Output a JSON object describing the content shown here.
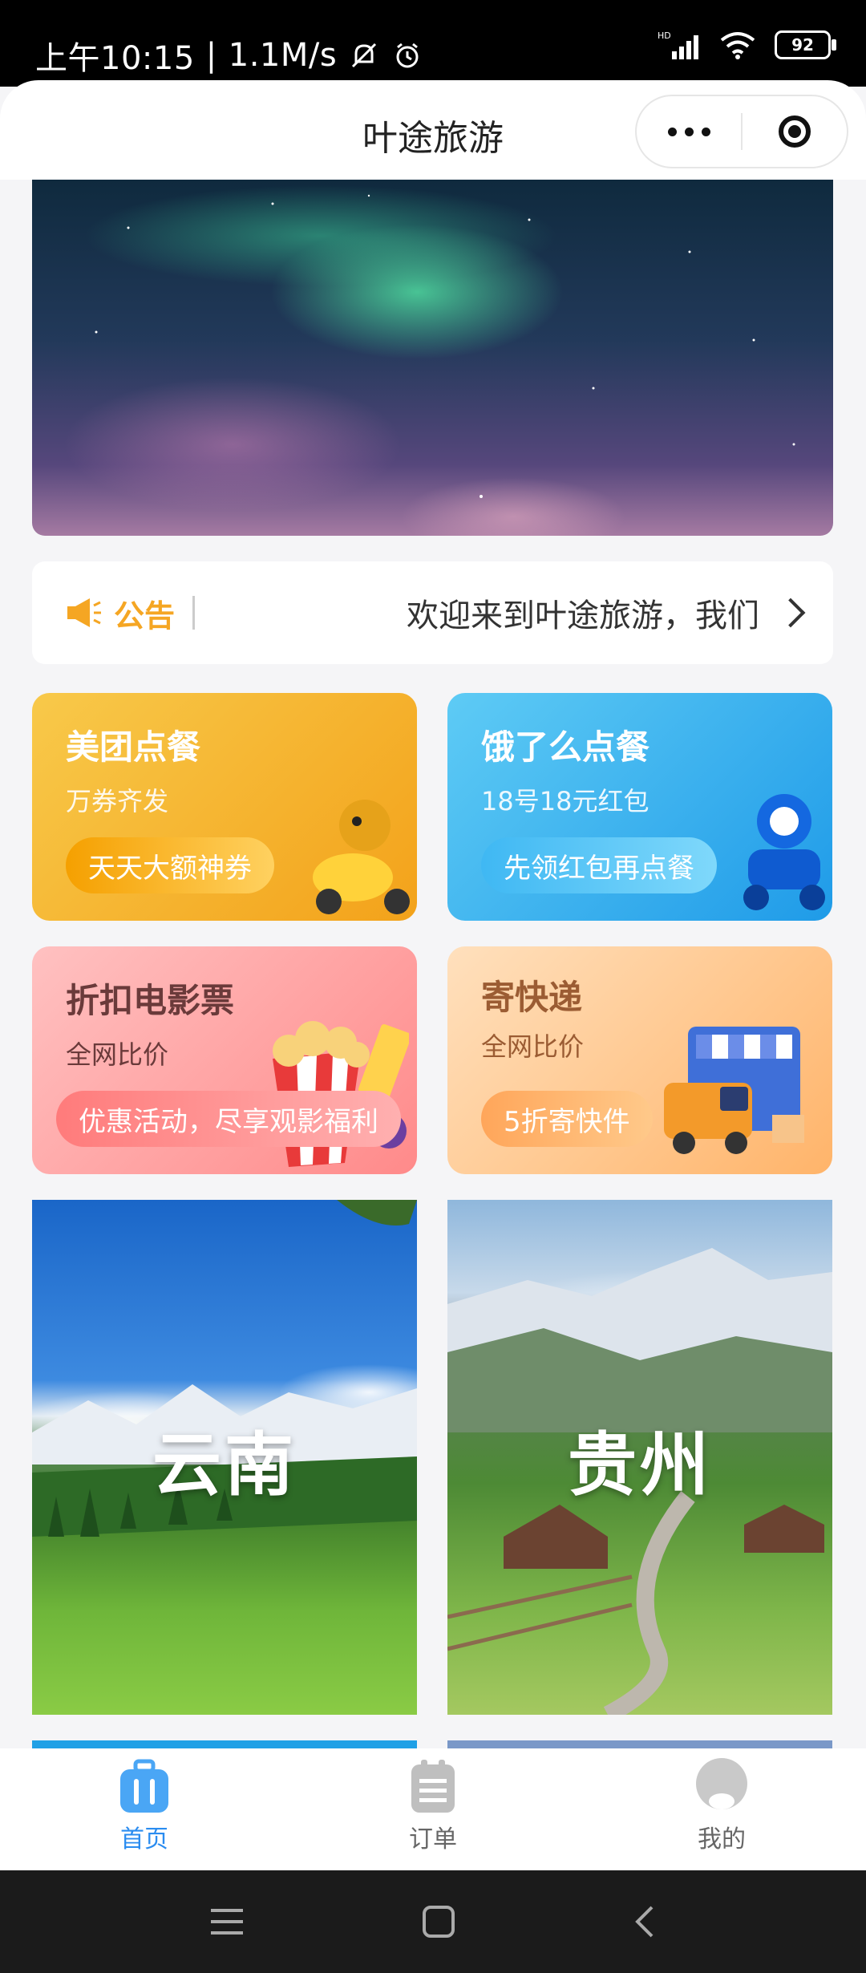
{
  "status_bar": {
    "time": "上午10:15",
    "speed": "1.1M/s",
    "battery": "92",
    "network": "HD"
  },
  "header": {
    "title": "叶途旅游"
  },
  "notice": {
    "label": "公告",
    "text": "欢迎来到叶途旅游，我们"
  },
  "services": [
    {
      "title": "美团点餐",
      "subtitle": "万券齐发",
      "button": "天天大额神券"
    },
    {
      "title": "饿了么点餐",
      "subtitle": "18号18元红包",
      "button": "先领红包再点餐"
    },
    {
      "title": "折扣电影票",
      "subtitle": "全网比价",
      "button": "优惠活动，尽享观影福利"
    },
    {
      "title": "寄快递",
      "subtitle": "全网比价",
      "button": "5折寄快件"
    }
  ],
  "destinations": [
    {
      "name": "云南"
    },
    {
      "name": "贵州"
    }
  ],
  "tabbar": {
    "items": [
      {
        "label": "首页",
        "icon": "luggage-icon",
        "active": true
      },
      {
        "label": "订单",
        "icon": "order-list-icon",
        "active": false
      },
      {
        "label": "我的",
        "icon": "user-icon",
        "active": false
      }
    ]
  },
  "colors": {
    "accent": "#2a8cf0",
    "notice": "#f5a623"
  }
}
